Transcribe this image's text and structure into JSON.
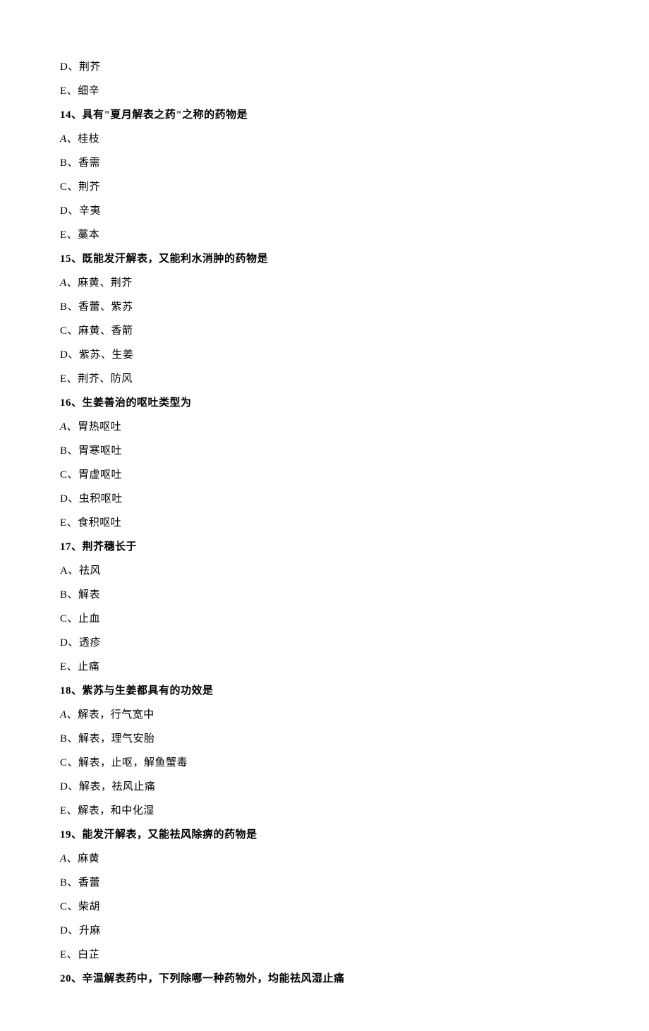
{
  "orphan_options": [
    {
      "letter": "D",
      "text": "荆芥"
    },
    {
      "letter": "E",
      "text": "细辛"
    }
  ],
  "questions": [
    {
      "num": "14",
      "text": "具有\"夏月解表之药\"之称的药物是",
      "options": [
        {
          "letter": "A",
          "text": "桂枝",
          "italic": true
        },
        {
          "letter": "B",
          "text": "香需"
        },
        {
          "letter": "C",
          "text": "荆芥"
        },
        {
          "letter": "D",
          "text": "辛夷"
        },
        {
          "letter": "E",
          "text": "藁本"
        }
      ]
    },
    {
      "num": "15",
      "text": "既能发汗解表，又能利水消肿的药物是",
      "options": [
        {
          "letter": "A",
          "text": "麻黄、荆芥",
          "italic": true
        },
        {
          "letter": "B",
          "text": "香蕾、紫苏"
        },
        {
          "letter": "C",
          "text": "麻黄、香箭"
        },
        {
          "letter": "D",
          "text": "紫苏、生姜"
        },
        {
          "letter": "E",
          "text": "荆芥、防风"
        }
      ]
    },
    {
      "num": "16",
      "text": "生姜善治的呕吐类型为",
      "options": [
        {
          "letter": "A",
          "text": "胃热呕吐",
          "italic": true
        },
        {
          "letter": "B",
          "text": "胃寒呕吐"
        },
        {
          "letter": "C",
          "text": "胃虚呕吐"
        },
        {
          "letter": "D",
          "text": "虫积呕吐"
        },
        {
          "letter": "E",
          "text": "食积呕吐"
        }
      ]
    },
    {
      "num": "17",
      "text": "荆芥穗长于",
      "options": [
        {
          "letter": "A",
          "text": "祛风"
        },
        {
          "letter": "B",
          "text": "解表"
        },
        {
          "letter": "C",
          "text": "止血"
        },
        {
          "letter": "D",
          "text": "透疹"
        },
        {
          "letter": "E",
          "text": "止痛"
        }
      ]
    },
    {
      "num": "18",
      "text": "紫苏与生姜都具有的功效是",
      "options": [
        {
          "letter": "A",
          "text": "解表，行气宽中",
          "italic": true
        },
        {
          "letter": "B",
          "text": "解表，理气安胎"
        },
        {
          "letter": "C",
          "text": "解表，止呕，解鱼蟹毒"
        },
        {
          "letter": "D",
          "text": "解表，祛风止痛"
        },
        {
          "letter": "E",
          "text": "解表，和中化湿"
        }
      ]
    },
    {
      "num": "19",
      "text": "能发汗解表，又能祛风除痹的药物是",
      "options": [
        {
          "letter": "A",
          "text": "麻黄",
          "italic": true
        },
        {
          "letter": "B",
          "text": "香蕾"
        },
        {
          "letter": "C",
          "text": "柴胡"
        },
        {
          "letter": "D",
          "text": "升麻"
        },
        {
          "letter": "E",
          "text": "白芷"
        }
      ]
    },
    {
      "num": "20",
      "text": "辛温解表药中，下列除哪一种药物外，均能祛风湿止痛",
      "options": []
    }
  ]
}
